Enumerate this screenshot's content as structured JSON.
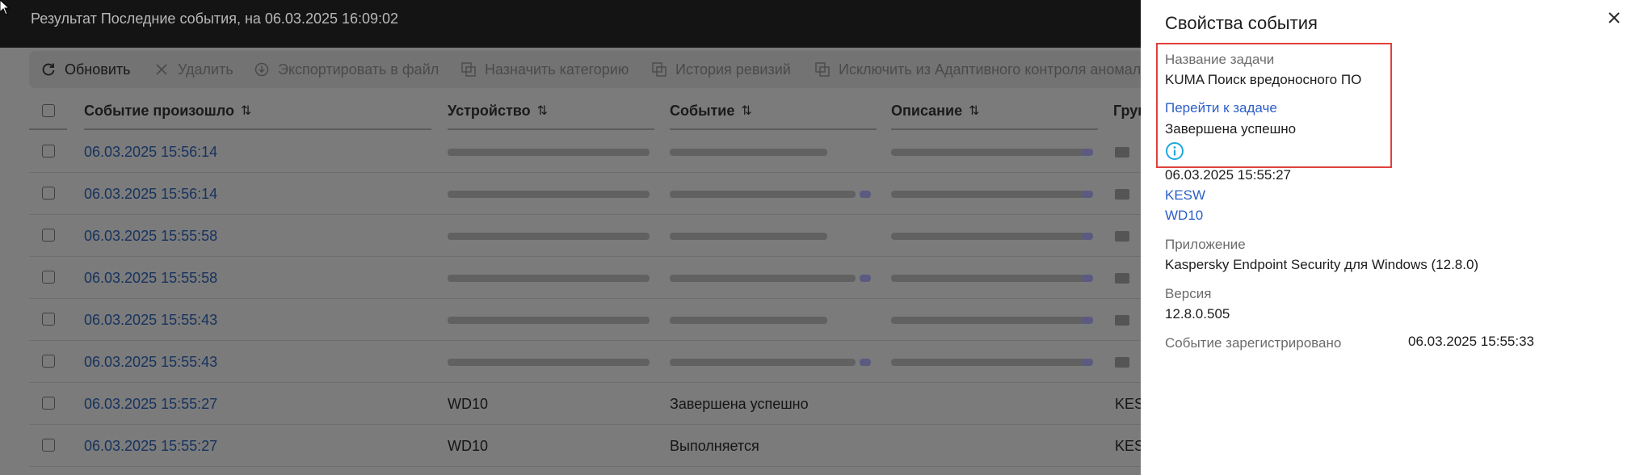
{
  "header": {
    "title": "Результат Последние события, на 06.03.2025 16:09:02"
  },
  "toolbar": {
    "refresh": "Обновить",
    "delete": "Удалить",
    "export": "Экспортировать в файл",
    "assign_category": "Назначить категорию",
    "revision_history": "История ревизий",
    "exclude": "Исключить из Адаптивного контроля аномалий"
  },
  "table": {
    "columns": [
      "Событие произошло",
      "Устройство",
      "Событие",
      "Описание",
      "Группа"
    ],
    "sort_icon": "⇅",
    "rows": [
      {
        "date": "06.03.2025 15:56:14",
        "device": "",
        "event": "",
        "group": ""
      },
      {
        "date": "06.03.2025 15:56:14",
        "device": "",
        "event": "",
        "group": ""
      },
      {
        "date": "06.03.2025 15:55:58",
        "device": "",
        "event": "",
        "group": ""
      },
      {
        "date": "06.03.2025 15:55:58",
        "device": "",
        "event": "",
        "group": ""
      },
      {
        "date": "06.03.2025 15:55:43",
        "device": "",
        "event": "",
        "group": ""
      },
      {
        "date": "06.03.2025 15:55:43",
        "device": "",
        "event": "",
        "group": ""
      },
      {
        "date": "06.03.2025 15:55:27",
        "device": "WD10",
        "event": "Завершена успешно",
        "group": "KESW"
      },
      {
        "date": "06.03.2025 15:55:27",
        "device": "WD10",
        "event": "Выполняется",
        "group": "KESW"
      }
    ]
  },
  "panel": {
    "title": "Свойства события",
    "task_label": "Название задачи",
    "task_value": "KUMA Поиск вредоносного ПО",
    "goto_task": "Перейти к задаче",
    "status": "Завершена успешно",
    "time": "06.03.2025 15:55:27",
    "group_link": "KESW",
    "device_link": "WD10",
    "app_label": "Приложение",
    "app_value": "Kaspersky Endpoint Security для Windows (12.8.0)",
    "version_label": "Версия",
    "version_value": "12.8.0.505",
    "registered_label": "Событие зарегистрировано",
    "registered_value": "06.03.2025 15:55:33"
  },
  "colors": {
    "link": "#2c5ec8",
    "highlight": "#e0413d",
    "info": "#1ea7e0"
  }
}
